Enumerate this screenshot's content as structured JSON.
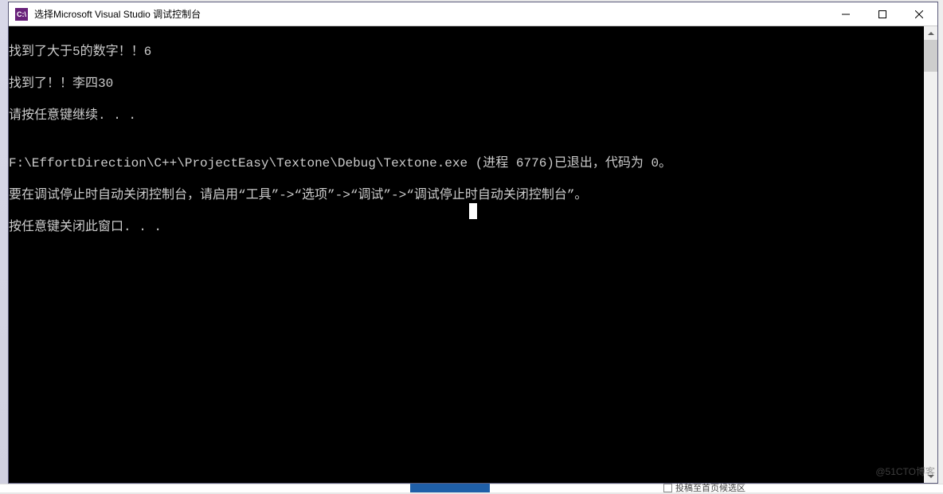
{
  "window": {
    "icon_text": "C:\\",
    "title": "选择Microsoft Visual Studio 调试控制台"
  },
  "console": {
    "lines": [
      "找到了大于5的数字！！6",
      "找到了！！李四30",
      "请按任意键继续. . .",
      "",
      "F:\\EffortDirection\\C++\\ProjectEasy\\Textone\\Debug\\Textone.exe (进程 6776)已退出，代码为 0。",
      "要在调试停止时自动关闭控制台，请启用“工具”->“选项”->“调试”->“调试停止时自动关闭控制台”。",
      "按任意键关闭此窗口. . ."
    ]
  },
  "bottom": {
    "checkbox_label": "投稿至首页候选区"
  },
  "watermark": "@51CTO博客"
}
